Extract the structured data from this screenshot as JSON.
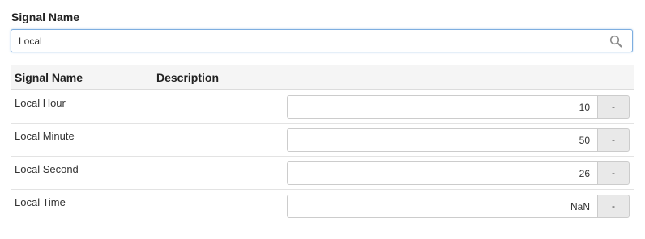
{
  "filter": {
    "label": "Signal Name",
    "value": "Local",
    "search_icon": "search-icon"
  },
  "table": {
    "columns": [
      "Signal Name",
      "Description"
    ],
    "rows": [
      {
        "name": "Local Hour",
        "description": "",
        "value": "10",
        "button_label": "-"
      },
      {
        "name": "Local Minute",
        "description": "",
        "value": "50",
        "button_label": "-"
      },
      {
        "name": "Local Second",
        "description": "",
        "value": "26",
        "button_label": "-"
      },
      {
        "name": "Local Time",
        "description": "",
        "value": "NaN",
        "button_label": "-"
      }
    ]
  },
  "colors": {
    "focus_border": "#7eaee0",
    "header_background": "#f5f5f5",
    "button_background": "#e9e9e9"
  }
}
